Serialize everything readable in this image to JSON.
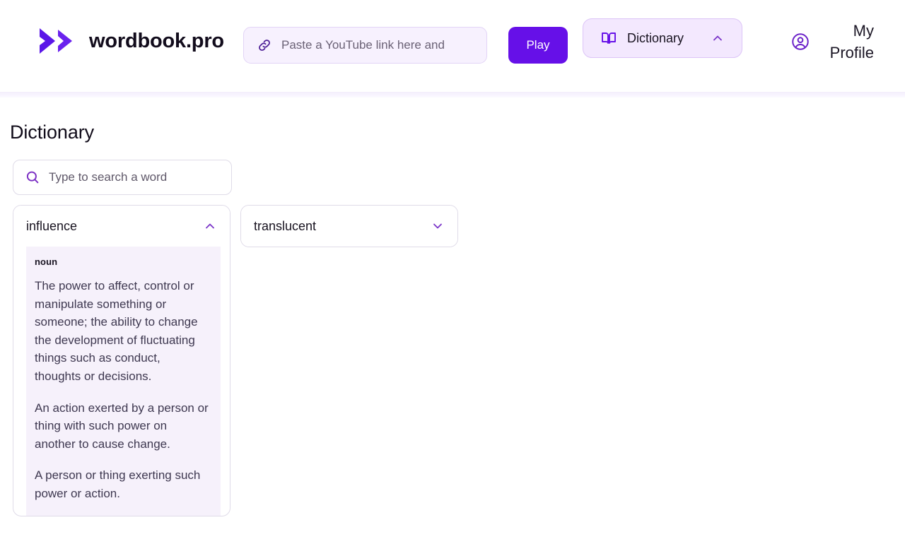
{
  "header": {
    "brand_name": "wordbook.pro",
    "brand_mark_icon": "double-chevron-right-icon",
    "youtube_input": {
      "value": "",
      "placeholder": "Paste a YouTube link here and",
      "icon": "link-icon"
    },
    "play_label": "Play",
    "dictionary": {
      "label": "Dictionary",
      "icon": "open-book-icon",
      "chevron": "chevron-up-icon"
    },
    "profile": {
      "label": "My Profile",
      "icon": "user-circle-icon"
    }
  },
  "main": {
    "title": "Dictionary",
    "search": {
      "value": "",
      "placeholder": "Type to search a word",
      "icon": "search-icon"
    },
    "cards": [
      {
        "word": "influence",
        "expanded": true,
        "chevron": "chevron-up-icon",
        "part_of_speech": "noun",
        "definitions": [
          "The power to affect, control or manipulate something or someone; the ability to change the development of fluctuating things such as conduct, thoughts or decisions.",
          "An action exerted by a person or thing with such power on another to cause change.",
          "A person or thing exerting such power or action."
        ]
      },
      {
        "word": "translucent",
        "expanded": false,
        "chevron": "chevron-down-icon",
        "part_of_speech": "",
        "definitions": []
      }
    ]
  },
  "colors": {
    "brand_purple": "#6610e8",
    "accent_purple": "#7b36c9",
    "panel_lavender": "#f6f1fb",
    "chip_lavender": "#f3e8fe",
    "field_lavender": "#f7f1fe",
    "border_grey": "#dfdbe8",
    "text_dark": "#17121f",
    "text_body": "#3e3850"
  }
}
